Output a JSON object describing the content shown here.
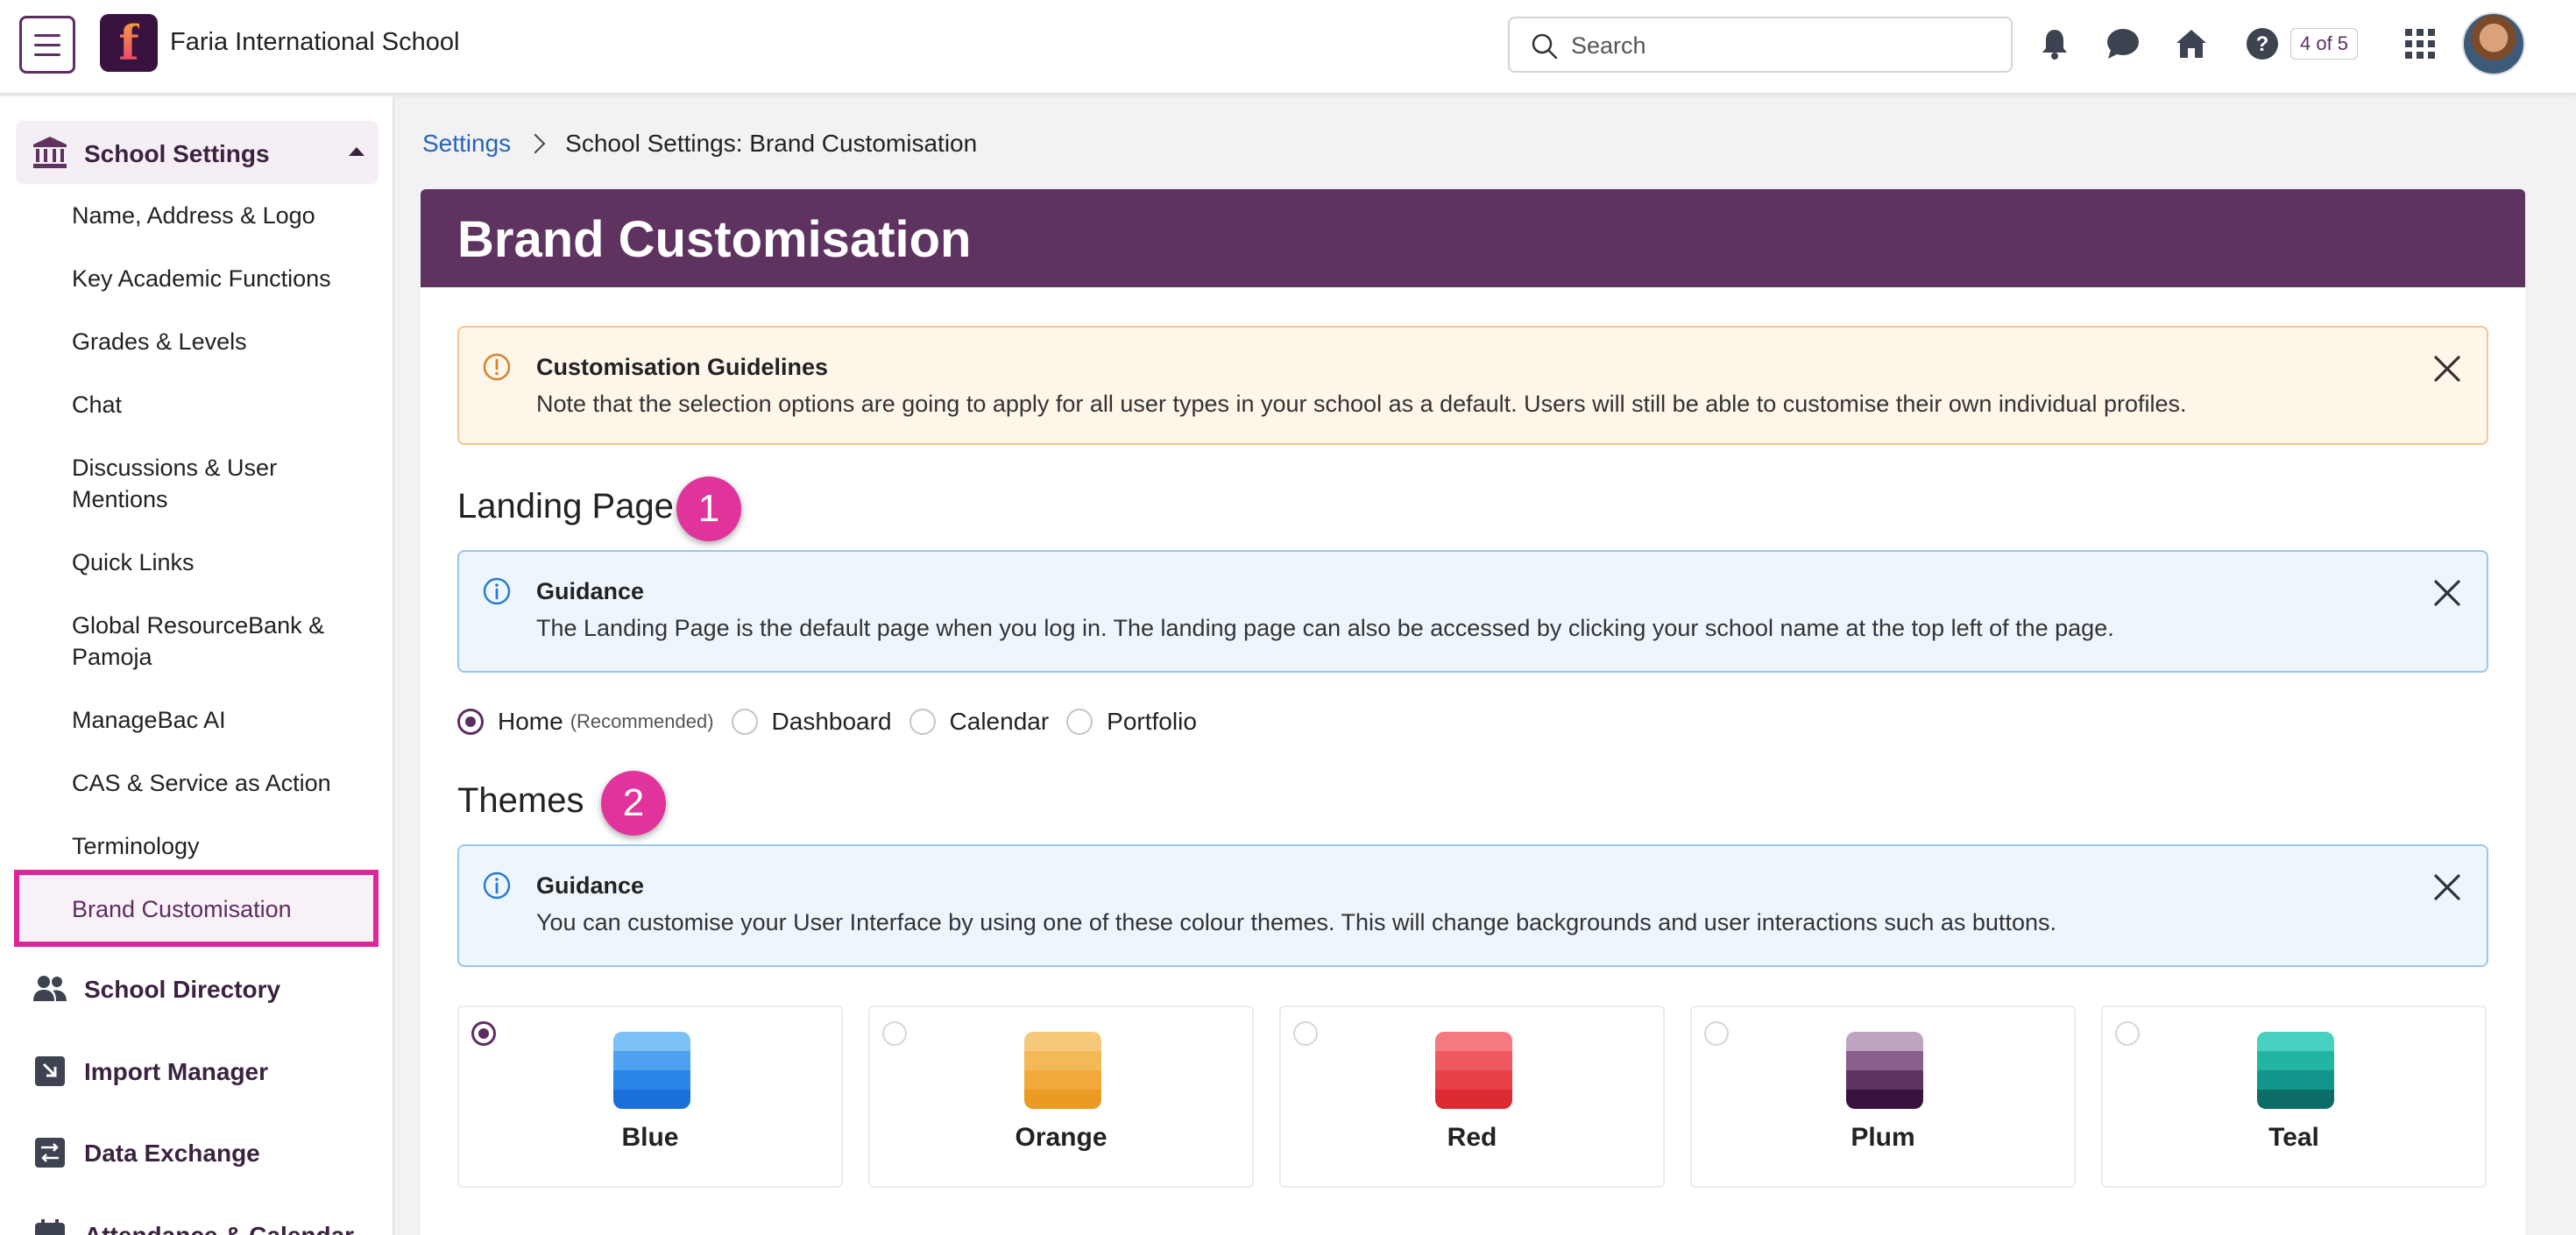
{
  "topbar": {
    "school_name": "Faria International School",
    "logo_letter": "f",
    "search_placeholder": "Search",
    "counter": "4 of 5",
    "icons": [
      "bell-icon",
      "chat-icon",
      "home-icon",
      "help-icon",
      "apps-grid-icon"
    ]
  },
  "sidebar": {
    "section_label": "School Settings",
    "items": [
      "Name, Address & Logo",
      "Key Academic Functions",
      "Grades & Levels",
      "Chat",
      "Discussions & User Mentions",
      "Quick Links",
      "Global ResourceBank & Pamoja",
      "ManageBac AI",
      "CAS & Service as Action",
      "Terminology",
      "Brand Customisation"
    ],
    "active_item": "Brand Customisation",
    "main_items": [
      "School Directory",
      "Import Manager",
      "Data Exchange",
      "Attendance & Calendar"
    ]
  },
  "breadcrumb": {
    "link": "Settings",
    "current": "School Settings: Brand Customisation"
  },
  "page": {
    "title": "Brand Customisation",
    "guidelines": {
      "title": "Customisation Guidelines",
      "text": "Note that the selection options are going to apply for all user types in your school as a default. Users will still be able to customise their own individual profiles."
    },
    "landing": {
      "title": "Landing Page",
      "step": "1",
      "guidance_title": "Guidance",
      "guidance_text": "The Landing Page is the default page when you log in. The landing page can also be accessed by clicking your school name at the top left of the page.",
      "options": [
        {
          "label": "Home",
          "hint": "(Recommended)",
          "selected": true
        },
        {
          "label": "Dashboard",
          "hint": "",
          "selected": false
        },
        {
          "label": "Calendar",
          "hint": "",
          "selected": false
        },
        {
          "label": "Portfolio",
          "hint": "",
          "selected": false
        }
      ]
    },
    "themes": {
      "title": "Themes",
      "step": "2",
      "guidance_title": "Guidance",
      "guidance_text": "You can customise your User Interface by using one of these colour themes. This will change backgrounds and user interactions such as buttons.",
      "options": [
        {
          "name": "Blue",
          "selected": true,
          "colors": [
            "#7cc0f7",
            "#4ea1f0",
            "#2b86ea",
            "#1a6fd8"
          ]
        },
        {
          "name": "Orange",
          "selected": false,
          "colors": [
            "#f6c97a",
            "#f3b956",
            "#f0a93a",
            "#e99b22"
          ]
        },
        {
          "name": "Red",
          "selected": false,
          "colors": [
            "#f47a80",
            "#ef5a61",
            "#ea4048",
            "#dc2a33"
          ]
        },
        {
          "name": "Plum",
          "selected": false,
          "colors": [
            "#bfa4c2",
            "#8a5f8e",
            "#5e3360",
            "#3a1240"
          ]
        },
        {
          "name": "Teal",
          "selected": false,
          "colors": [
            "#48d1c0",
            "#22b5a4",
            "#12958a",
            "#0b6d66"
          ]
        }
      ]
    }
  },
  "colors": {
    "brand": "#5e3360",
    "accent_pink": "#e0349c",
    "link": "#2764b8"
  }
}
